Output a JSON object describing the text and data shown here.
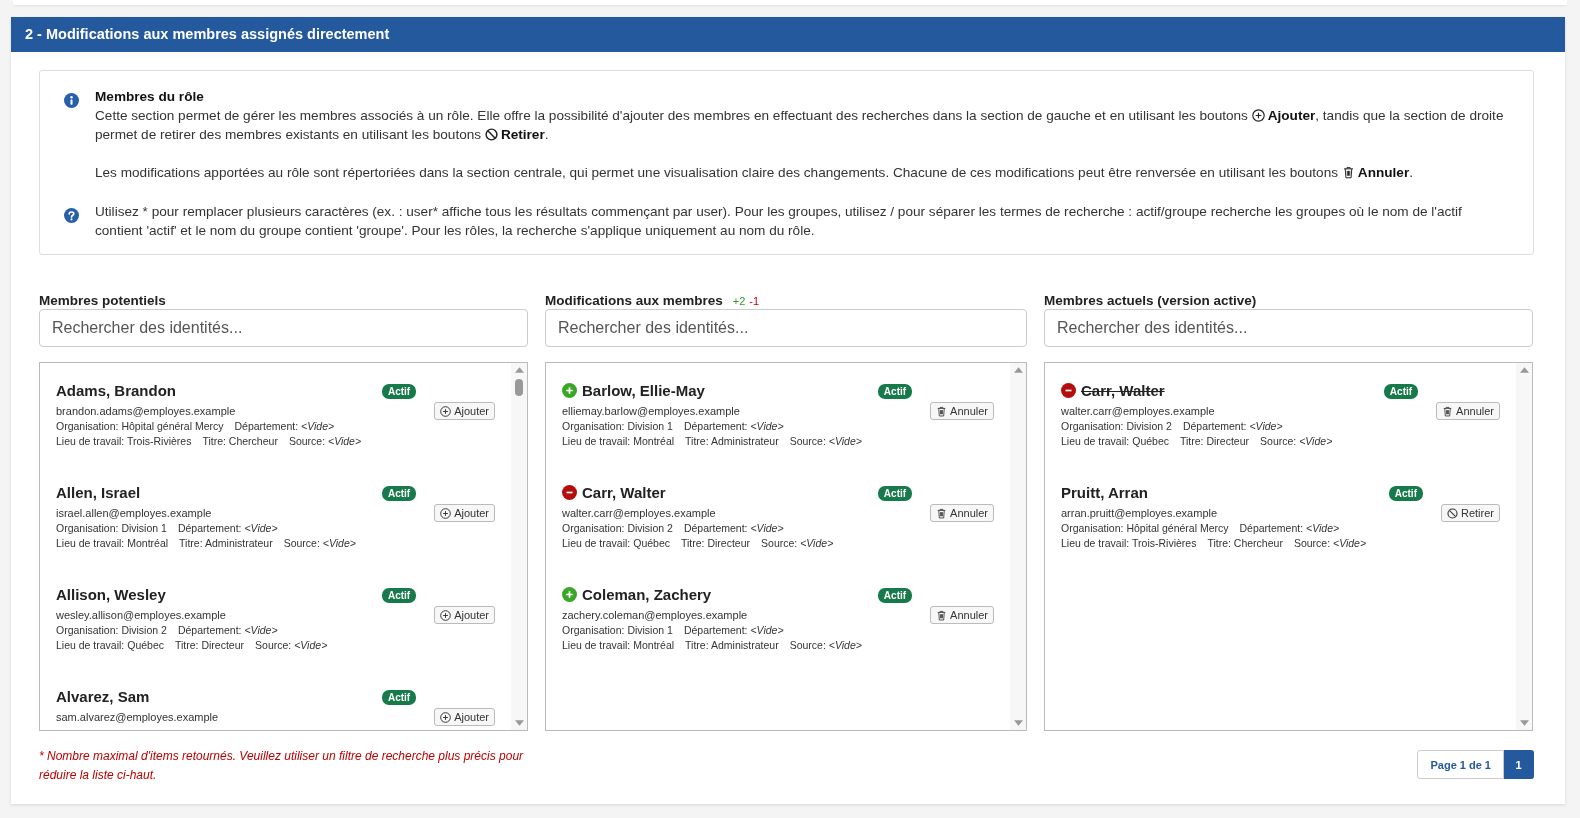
{
  "section": {
    "title": "2 - Modifications aux membres assignés directement"
  },
  "info": {
    "notes": [
      {
        "kind": "info",
        "title": "Membres du rôle",
        "paragraphs": [
          [
            {
              "kind": "text",
              "text": "Cette section permet de gérer les membres associés à un rôle. Elle offre la possibilité d'ajouter des membres en effectuant des recherches dans la section de gauche et en utilisant les boutons "
            },
            {
              "kind": "add"
            },
            {
              "kind": "text",
              "text": "**Ajouter**, tandis que la section de droite permet de retirer des membres existants en utilisant les boutons "
            },
            {
              "kind": "remove"
            },
            {
              "kind": "text",
              "text": "**Retirer**."
            }
          ],
          [
            {
              "kind": "text",
              "text": "Les modifications apportées au rôle sont répertoriées dans la section centrale, qui permet une visualisation claire des changements. Chacune de ces modifications peut être renversée en utilisant les boutons "
            },
            {
              "kind": "cancel"
            },
            {
              "kind": "text",
              "text": "**Annuler**."
            }
          ]
        ]
      },
      {
        "kind": "help",
        "paragraphs": [
          [
            {
              "kind": "text",
              "text": "Utilisez * pour remplacer plusieurs caractères (ex. : user* affiche tous les résultats commençant par user). Pour les groupes, utilisez / pour séparer les termes de recherche : actif/groupe recherche les groupes où le nom de l'actif contient 'actif' et le nom du groupe contient 'groupe'. Pour les rôles, la recherche s'applique uniquement au nom du rôle."
            }
          ]
        ]
      }
    ]
  },
  "columns": [
    {
      "title": "Membres potentiels",
      "search": {
        "placeholder": "Rechercher des identités..."
      },
      "scrollable": true,
      "members": [
        {
          "name": "Adams, Brandon",
          "kind": "unchanged",
          "struck": false,
          "status": "Actif",
          "email": "brandon.adams@employes.example",
          "fields": [
            {
              "label": "Organisation:",
              "value": "Hôpital général Mercy",
              "empty": false
            },
            {
              "label": "Département:",
              "value": "<Vide>",
              "empty": true
            },
            {
              "label": "Lieu de travail:",
              "value": "Trois-Rivières",
              "empty": false
            },
            {
              "label": "Titre:",
              "value": "Chercheur",
              "empty": false
            },
            {
              "label": "Source:",
              "value": "<Vide>",
              "empty": true
            }
          ],
          "action": {
            "kind": "add",
            "label": "Ajouter"
          }
        },
        {
          "name": "Allen, Israel",
          "kind": "unchanged",
          "struck": false,
          "status": "Actif",
          "email": "israel.allen@employes.example",
          "fields": [
            {
              "label": "Organisation:",
              "value": "Division 1",
              "empty": false
            },
            {
              "label": "Département:",
              "value": "<Vide>",
              "empty": true
            },
            {
              "label": "Lieu de travail:",
              "value": "Montréal",
              "empty": false
            },
            {
              "label": "Titre:",
              "value": "Administrateur",
              "empty": false
            },
            {
              "label": "Source:",
              "value": "<Vide>",
              "empty": true
            }
          ],
          "action": {
            "kind": "add",
            "label": "Ajouter"
          }
        },
        {
          "name": "Allison, Wesley",
          "kind": "unchanged",
          "struck": false,
          "status": "Actif",
          "email": "wesley.allison@employes.example",
          "fields": [
            {
              "label": "Organisation:",
              "value": "Division 2",
              "empty": false
            },
            {
              "label": "Département:",
              "value": "<Vide>",
              "empty": true
            },
            {
              "label": "Lieu de travail:",
              "value": "Québec",
              "empty": false
            },
            {
              "label": "Titre:",
              "value": "Directeur",
              "empty": false
            },
            {
              "label": "Source:",
              "value": "<Vide>",
              "empty": true
            }
          ],
          "action": {
            "kind": "add",
            "label": "Ajouter"
          }
        },
        {
          "name": "Alvarez, Sam",
          "kind": "unchanged",
          "struck": false,
          "status": "Actif",
          "email": "sam.alvarez@employes.example",
          "action": {
            "kind": "add",
            "label": "Ajouter"
          }
        }
      ]
    },
    {
      "title": "Modifications aux membres",
      "counts": [
        {
          "kind": "added",
          "text": "+2"
        },
        {
          "kind": "removed",
          "text": "-1"
        }
      ],
      "search": {
        "placeholder": "Rechercher des identités..."
      },
      "scrollable": false,
      "members": [
        {
          "name": "Barlow, Ellie-May",
          "kind": "added",
          "struck": false,
          "status": "Actif",
          "email": "elliemay.barlow@employes.example",
          "fields": [
            {
              "label": "Organisation:",
              "value": "Division 1",
              "empty": false
            },
            {
              "label": "Département:",
              "value": "<Vide>",
              "empty": true
            },
            {
              "label": "Lieu de travail:",
              "value": "Montréal",
              "empty": false
            },
            {
              "label": "Titre:",
              "value": "Administrateur",
              "empty": false
            },
            {
              "label": "Source:",
              "value": "<Vide>",
              "empty": true
            }
          ],
          "action": {
            "kind": "cancel",
            "label": "Annuler"
          }
        },
        {
          "name": "Carr, Walter",
          "kind": "removed",
          "struck": false,
          "status": "Actif",
          "email": "walter.carr@employes.example",
          "fields": [
            {
              "label": "Organisation:",
              "value": "Division 2",
              "empty": false
            },
            {
              "label": "Département:",
              "value": "<Vide>",
              "empty": true
            },
            {
              "label": "Lieu de travail:",
              "value": "Québec",
              "empty": false
            },
            {
              "label": "Titre:",
              "value": "Directeur",
              "empty": false
            },
            {
              "label": "Source:",
              "value": "<Vide>",
              "empty": true
            }
          ],
          "action": {
            "kind": "cancel",
            "label": "Annuler"
          }
        },
        {
          "name": "Coleman, Zachery",
          "kind": "added",
          "struck": false,
          "status": "Actif",
          "email": "zachery.coleman@employes.example",
          "fields": [
            {
              "label": "Organisation:",
              "value": "Division 1",
              "empty": false
            },
            {
              "label": "Département:",
              "value": "<Vide>",
              "empty": true
            },
            {
              "label": "Lieu de travail:",
              "value": "Montréal",
              "empty": false
            },
            {
              "label": "Titre:",
              "value": "Administrateur",
              "empty": false
            },
            {
              "label": "Source:",
              "value": "<Vide>",
              "empty": true
            }
          ],
          "action": {
            "kind": "cancel",
            "label": "Annuler"
          }
        }
      ]
    },
    {
      "title": "Membres actuels (version active)",
      "search": {
        "placeholder": "Rechercher des identités..."
      },
      "scrollable": false,
      "members": [
        {
          "name": "Carr, Walter",
          "kind": "removed",
          "struck": true,
          "status": "Actif",
          "email": "walter.carr@employes.example",
          "fields": [
            {
              "label": "Organisation:",
              "value": "Division 2",
              "empty": false
            },
            {
              "label": "Département:",
              "value": "<Vide>",
              "empty": true
            },
            {
              "label": "Lieu de travail:",
              "value": "Québec",
              "empty": false
            },
            {
              "label": "Titre:",
              "value": "Directeur",
              "empty": false
            },
            {
              "label": "Source:",
              "value": "<Vide>",
              "empty": true
            }
          ],
          "action": {
            "kind": "cancel",
            "label": "Annuler"
          }
        },
        {
          "name": "Pruitt, Arran",
          "kind": "unchanged",
          "struck": false,
          "status": "Actif",
          "email": "arran.pruitt@employes.example",
          "fields": [
            {
              "label": "Organisation:",
              "value": "Hôpital général Mercy",
              "empty": false
            },
            {
              "label": "Département:",
              "value": "<Vide>",
              "empty": true
            },
            {
              "label": "Lieu de travail:",
              "value": "Trois-Rivières",
              "empty": false
            },
            {
              "label": "Titre:",
              "value": "Chercheur",
              "empty": false
            },
            {
              "label": "Source:",
              "value": "<Vide>",
              "empty": true
            }
          ],
          "action": {
            "kind": "remove",
            "label": "Retirer"
          }
        }
      ]
    }
  ],
  "footer_note": "* Nombre maximal d'items retournés. Veuillez utiliser un filtre de recherche plus précis pour réduire la liste ci-haut.",
  "pagination": {
    "summary": "Page 1 de 1",
    "pages": [
      {
        "label": "1",
        "selected": true
      }
    ]
  }
}
